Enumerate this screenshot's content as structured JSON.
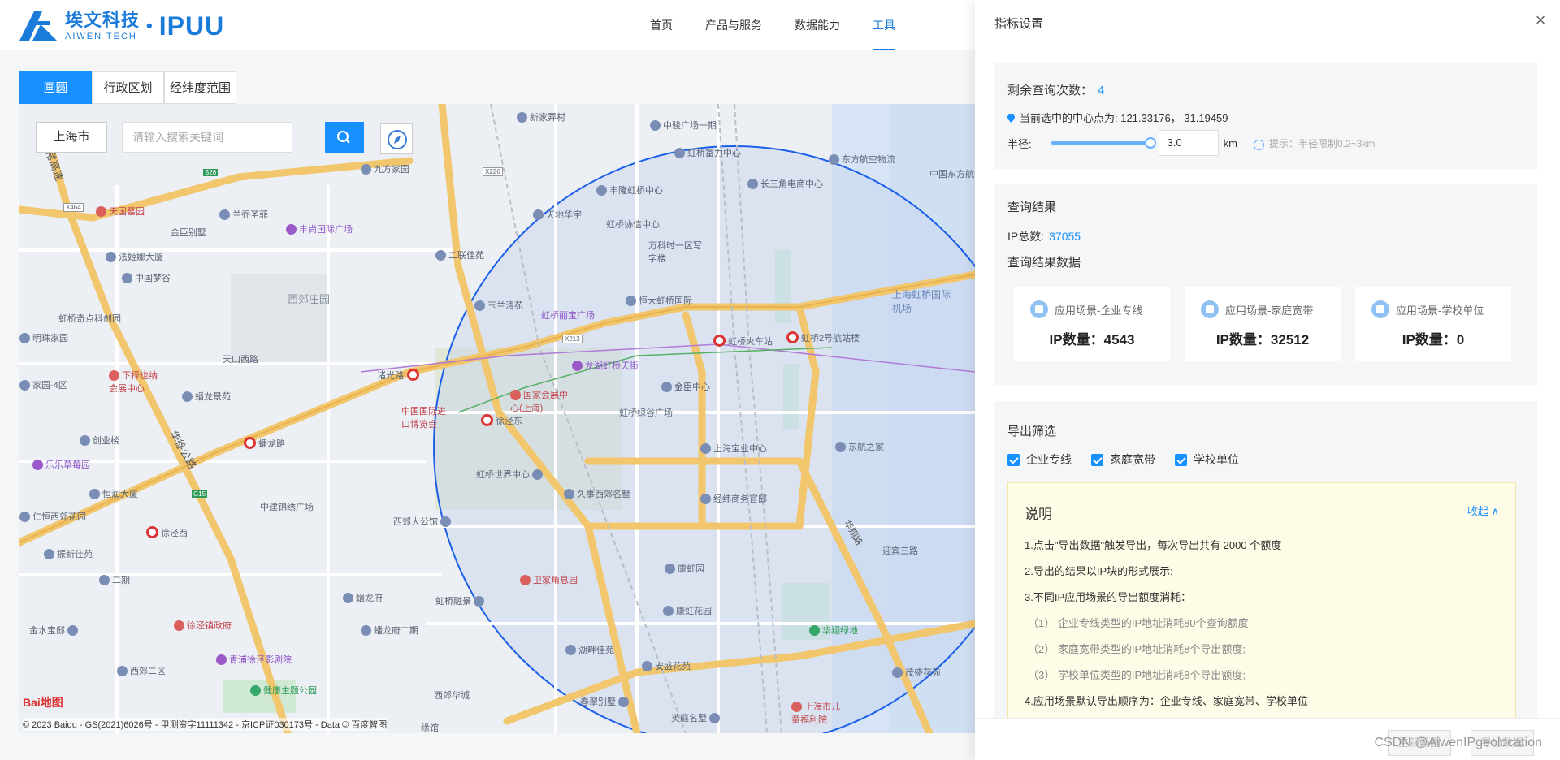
{
  "header": {
    "logo_cn": "埃文科技",
    "logo_en": "AIWEN TECH",
    "brand": "IPUU",
    "nav": [
      "首页",
      "产品与服务",
      "数据能力",
      "工具"
    ],
    "active_nav": "工具"
  },
  "map_tabs": [
    "画圆",
    "行政区划",
    "经纬度范围"
  ],
  "map": {
    "city": "上海市",
    "search_placeholder": "请输入搜索关键词",
    "labels": [
      {
        "text": "新家弄村",
        "kind": "poi"
      },
      {
        "text": "中骏广场一期",
        "kind": "poi"
      },
      {
        "text": "虹桥富力中心",
        "kind": "poi"
      },
      {
        "text": "东方航空物流",
        "kind": "poi"
      },
      {
        "text": "中国东方航空",
        "kind": "plain"
      },
      {
        "text": "九方家园",
        "kind": "poi"
      },
      {
        "text": "丰隆虹桥中心",
        "kind": "poi"
      },
      {
        "text": "长三角电商中心",
        "kind": "poi"
      },
      {
        "text": "天国墓园",
        "kind": "poi-red"
      },
      {
        "text": "兰乔圣菲",
        "kind": "poi"
      },
      {
        "text": "金臣别墅",
        "kind": "poi"
      },
      {
        "text": "丰尚国际广场",
        "kind": "poi-purple"
      },
      {
        "text": "天地华宇",
        "kind": "poi"
      },
      {
        "text": "虹桥协信中心",
        "kind": "poi"
      },
      {
        "text": "万科时一区写字楼",
        "kind": "poi"
      },
      {
        "text": "法姬娜大厦",
        "kind": "poi"
      },
      {
        "text": "二联佳苑",
        "kind": "poi"
      },
      {
        "text": "中国梦谷",
        "kind": "poi"
      },
      {
        "text": "西郊庄园",
        "kind": "big"
      },
      {
        "text": "玉兰清苑",
        "kind": "poi"
      },
      {
        "text": "恒大虹桥国际",
        "kind": "poi"
      },
      {
        "text": "上海虹桥国际机场",
        "kind": "blue"
      },
      {
        "text": "虹桥丽宝广场",
        "kind": "poi-purple"
      },
      {
        "text": "虹桥奇点科创园",
        "kind": "poi"
      },
      {
        "text": "明珠家园",
        "kind": "poi"
      },
      {
        "text": "天山西路",
        "kind": "plain"
      },
      {
        "text": "虹桥火车站",
        "kind": "station"
      },
      {
        "text": "虹桥2号航站楼",
        "kind": "station"
      },
      {
        "text": "龙湖虹桥天街",
        "kind": "poi-purple"
      },
      {
        "text": "诸光路",
        "kind": "station"
      },
      {
        "text": "下择也纳会展中心",
        "kind": "poi-red"
      },
      {
        "text": "家园-4区",
        "kind": "poi"
      },
      {
        "text": "蟠龙景苑",
        "kind": "poi"
      },
      {
        "text": "金臣中心",
        "kind": "poi"
      },
      {
        "text": "国家会展中心(上海)",
        "kind": "poi-red"
      },
      {
        "text": "中国国际进口博览会",
        "kind": "poi-red"
      },
      {
        "text": "徐泾东",
        "kind": "station"
      },
      {
        "text": "虹桥绿谷广场",
        "kind": "poi"
      },
      {
        "text": "东航之家",
        "kind": "poi"
      },
      {
        "text": "创业楼",
        "kind": "poi"
      },
      {
        "text": "蟠龙路",
        "kind": "station"
      },
      {
        "text": "上海宝业中心",
        "kind": "poi"
      },
      {
        "text": "乐乐草莓园",
        "kind": "poi-purple"
      },
      {
        "text": "虹桥世界中心",
        "kind": "poi"
      },
      {
        "text": "恒润大厦",
        "kind": "poi"
      },
      {
        "text": "久事西郊名墅",
        "kind": "poi"
      },
      {
        "text": "经纬商务官邸",
        "kind": "poi"
      },
      {
        "text": "仁恒西郊花园",
        "kind": "poi"
      },
      {
        "text": "中建锦绣广场",
        "kind": "plain"
      },
      {
        "text": "西郊大公馆",
        "kind": "poi"
      },
      {
        "text": "徐泾西",
        "kind": "station"
      },
      {
        "text": "迎宾三路",
        "kind": "plain"
      },
      {
        "text": "振新佳苑",
        "kind": "poi"
      },
      {
        "text": "康虹园",
        "kind": "poi"
      },
      {
        "text": "二期",
        "kind": "poi"
      },
      {
        "text": "卫家角息园",
        "kind": "poi-red"
      },
      {
        "text": "蟠龙府",
        "kind": "poi"
      },
      {
        "text": "虹桥融景",
        "kind": "poi"
      },
      {
        "text": "康虹花园",
        "kind": "poi"
      },
      {
        "text": "金水宝邸",
        "kind": "poi"
      },
      {
        "text": "徐泾镇政府",
        "kind": "poi-red"
      },
      {
        "text": "蟠龙府二期",
        "kind": "poi"
      },
      {
        "text": "华翔绿地",
        "kind": "poi-green"
      },
      {
        "text": "湖畔佳苑",
        "kind": "poi"
      },
      {
        "text": "青浦徐泾影剧院",
        "kind": "poi-purple"
      },
      {
        "text": "西郊二区",
        "kind": "poi"
      },
      {
        "text": "安盛花苑",
        "kind": "poi"
      },
      {
        "text": "茂盛花苑",
        "kind": "poi"
      },
      {
        "text": "健康主题公园",
        "kind": "poi-green"
      },
      {
        "text": "西郊华城",
        "kind": "plain"
      },
      {
        "text": "春翠别墅",
        "kind": "poi"
      },
      {
        "text": "上海市儿童福利院",
        "kind": "poi-red"
      },
      {
        "text": "英庭名墅",
        "kind": "poi"
      },
      {
        "text": "缘馆",
        "kind": "plain"
      }
    ],
    "roads": [
      "沪常高速",
      "华徐公路",
      "X464",
      "X226",
      "X213",
      "S26",
      "G15",
      "华翔路"
    ],
    "baidu_logo": "Bai地图",
    "copyright": "© 2023 Baidu - GS(2021)6026号 - 甲测资字11111342 - 京ICP证030173号 - Data © 百度智图"
  },
  "drawer": {
    "title": "指标设置",
    "remain_label": "剩余查询次数：",
    "remain_value": "4",
    "center_label": "当前选中的中心点为: 121.33176， 31.19459",
    "radius_label": "半径:",
    "radius_value": "3.0",
    "radius_min": 0.2,
    "radius_max": 3,
    "radius_unit": "km",
    "radius_hint": "提示：半径限制0.2~3km",
    "result_title": "查询结果",
    "ip_total_label": "IP总数:",
    "ip_total_value": "37055",
    "result_data_title": "查询结果数据",
    "results": [
      {
        "scene": "应用场景-企业专线",
        "count_label": "IP数量：4543"
      },
      {
        "scene": "应用场景-家庭宽带",
        "count_label": "IP数量：32512"
      },
      {
        "scene": "应用场景-学校单位",
        "count_label": "IP数量：0"
      }
    ],
    "export_title": "导出筛选",
    "export_options": [
      "企业专线",
      "家庭宽带",
      "学校单位"
    ],
    "note_title": "说明",
    "note_toggle": "收起",
    "note_lines": [
      "1.点击\"导出数据\"触发导出，每次导出共有 2000 个额度",
      "2.导出的结果以IP块的形式展示;",
      "3.不同IP应用场景的导出额度消耗：",
      "（1） 企业专线类型的IP地址消耗80个查询额度;",
      "（2） 家庭宽带类型的IP地址消耗8个导出额度;",
      "（3） 学校单位类型的IP地址消耗8个导出额度;",
      "4.应用场景默认导出顺序为：企业专线、家庭宽带、学校单位"
    ],
    "btn_redraw": "重新画圆",
    "btn_export": "导出数据"
  },
  "watermark": "CSDN @AiwenIPgeolocation",
  "colors": {
    "accent": "#1890ff",
    "brand": "#1a7bd9",
    "note_bg": "#fefbe6"
  }
}
